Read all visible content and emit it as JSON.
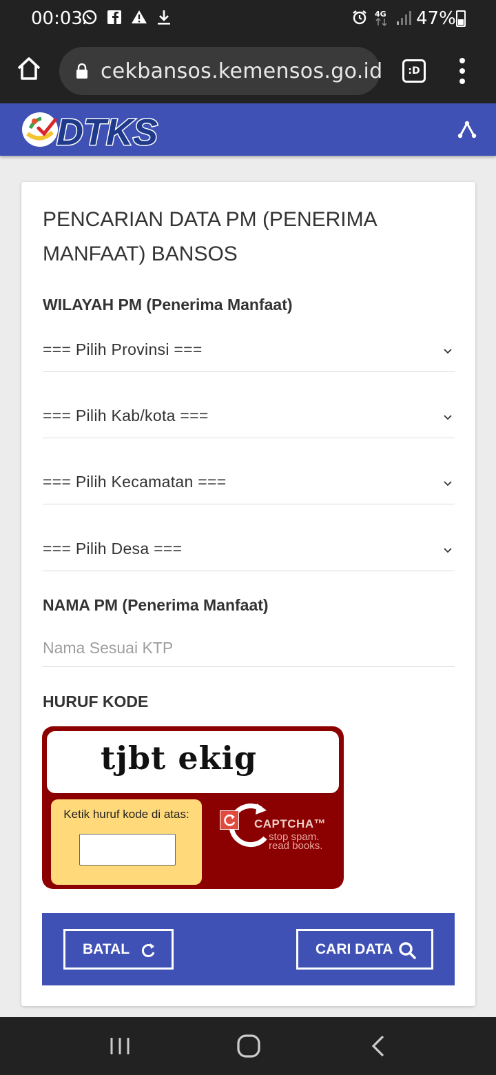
{
  "status_bar": {
    "time": "00:03",
    "battery": "47%",
    "network": "4G",
    "left_icons": [
      "whatsapp-icon",
      "facebook-icon",
      "warning-icon",
      "download-icon"
    ],
    "right_icons": [
      "alarm-icon",
      "network-4g-icon",
      "signal-icon",
      "battery-icon"
    ]
  },
  "browser": {
    "url": "cekbansos.kemensos.go.id",
    "tab_label": ":D"
  },
  "site": {
    "logo_text": "DTKS"
  },
  "form": {
    "title": "PENCARIAN DATA PM (PENERIMA MANFAAT) BANSOS",
    "region_label": "WILAYAH PM (Penerima Manfaat)",
    "selects": {
      "provinsi": "=== Pilih Provinsi ===",
      "kabkota": "=== Pilih Kab/kota ===",
      "kecamatan": "=== Pilih Kecamatan ===",
      "desa": "=== Pilih Desa ==="
    },
    "name_label": "NAMA PM (Penerima Manfaat)",
    "name_placeholder": "Nama Sesuai KTP",
    "name_value": "",
    "code_label": "HURUF KODE",
    "captcha": {
      "word": "tjbt ekig",
      "prompt": "Ketik huruf kode di atas:",
      "input_value": "",
      "brand": "CAPTCHA™",
      "slogan_line1": "stop spam.",
      "slogan_line2": "read books."
    },
    "buttons": {
      "cancel": "BATAL",
      "search": "CARI DATA"
    }
  },
  "colors": {
    "status_bar": "#222222",
    "header": "#3f51b5",
    "captcha_bg": "#8b0000",
    "captcha_panel": "#ffd97a"
  }
}
